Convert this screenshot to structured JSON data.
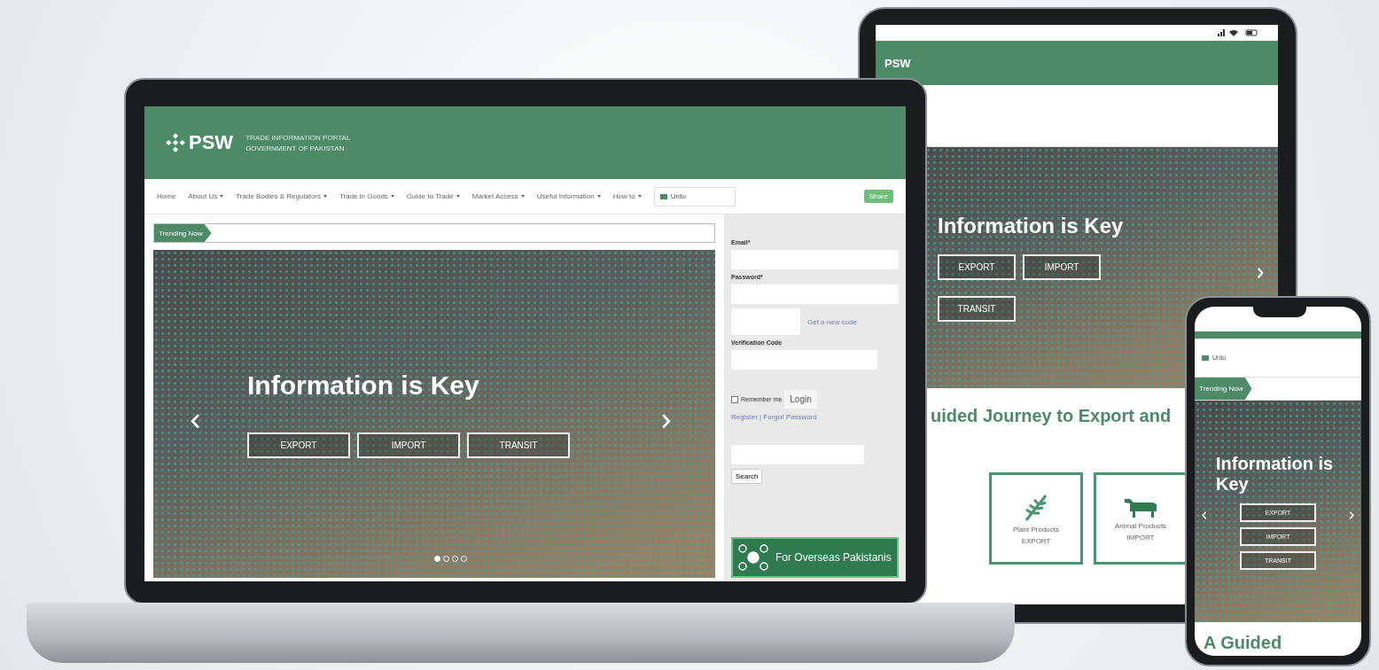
{
  "laptop": {
    "header": {
      "logo": "PSW",
      "lines": [
        "TRADE INFORMATION PORTAL",
        "GOVERNMENT OF PAKISTAN"
      ]
    },
    "nav": [
      {
        "label": "Home",
        "dropdown": false
      },
      {
        "label": "About Us",
        "dropdown": true
      },
      {
        "label": "Trade Bodies & Regulators",
        "dropdown": true
      },
      {
        "label": "Trade in Goods",
        "dropdown": true
      },
      {
        "label": "Guide to Trade",
        "dropdown": true
      },
      {
        "label": "Market Access",
        "dropdown": true
      },
      {
        "label": "Useful Information",
        "dropdown": true
      },
      {
        "label": "How to",
        "dropdown": true
      }
    ],
    "language": "Urdu",
    "share": "Share",
    "ticker": "Trending Now",
    "hero": {
      "title": "Information is Key",
      "buttons": [
        "EXPORT",
        "IMPORT",
        "TRANSIT"
      ],
      "slides": [
        {
          "selected": true
        },
        {
          "selected": false
        },
        {
          "selected": false
        },
        {
          "selected": false
        }
      ]
    },
    "login": {
      "fields": [
        {
          "label": "Email*"
        },
        {
          "label": "Password*"
        }
      ],
      "new_code_link": "Get a new code",
      "verification_label": "Verification Code",
      "remember": {
        "label": "Remember me",
        "checked": false
      },
      "login_button": "Login",
      "links": "Register | Forgot Password"
    },
    "search_button": "Search",
    "banner": "For Overseas Pakistanis"
  },
  "tablet": {
    "logo": "PSW",
    "hero": {
      "title": "Information is Key",
      "buttons": [
        "EXPORT",
        "IMPORT",
        "TRANSIT"
      ]
    },
    "heading": "uided Journey to Export and",
    "cards": [
      {
        "kind": "plant",
        "name": "Plant Products",
        "action": "EXPORT"
      },
      {
        "kind": "animal",
        "name": "Animal Products",
        "action": "IMPORT"
      }
    ]
  },
  "phone": {
    "language": "Urdu",
    "ticker": "Trending Now",
    "hero": {
      "title": "Information is Key",
      "buttons": [
        "EXPORT",
        "IMPORT",
        "TRANSIT"
      ]
    },
    "heading": "A Guided"
  }
}
